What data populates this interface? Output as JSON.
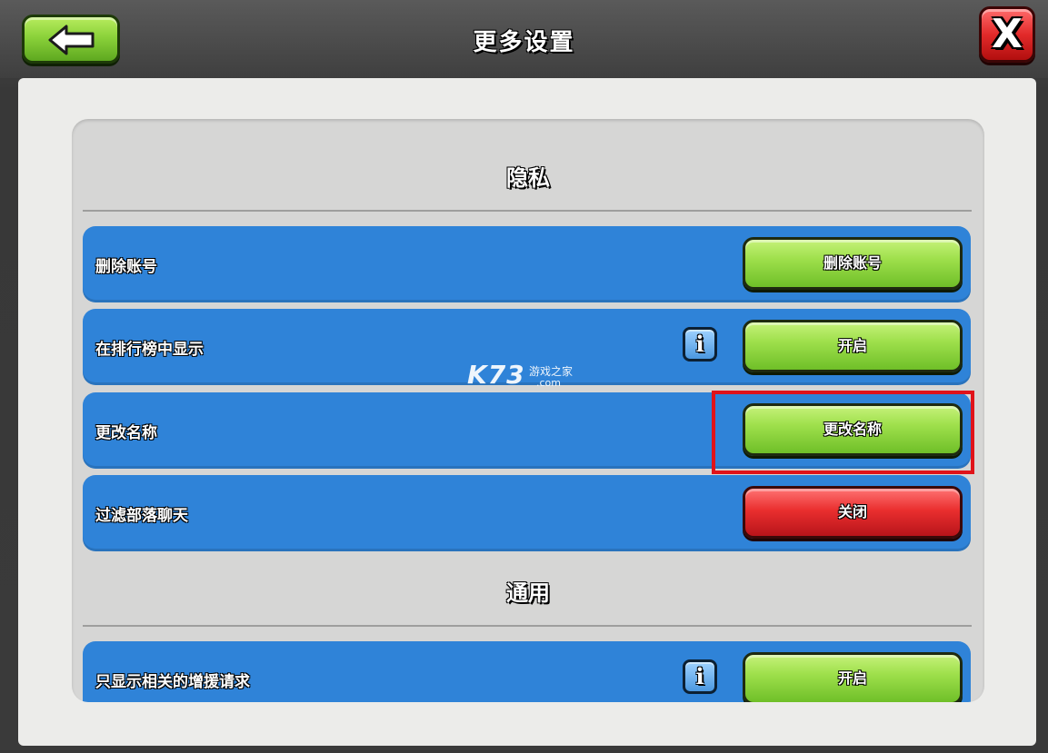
{
  "header": {
    "title": "更多设置"
  },
  "close_label": "X",
  "sections": {
    "privacy": {
      "title": "隐私",
      "rows": [
        {
          "label": "删除账号",
          "button": "删除账号"
        },
        {
          "label": "在排行榜中显示",
          "button": "开启"
        },
        {
          "label": "更改名称",
          "button": "更改名称"
        },
        {
          "label": "过滤部落聊天",
          "button": "关闭"
        }
      ]
    },
    "general": {
      "title": "通用",
      "rows": [
        {
          "label": "只显示相关的增援请求",
          "button": "开启"
        }
      ]
    }
  },
  "info_glyph": "i",
  "watermark": {
    "logo": "K73",
    "sub": "游戏之家",
    "domain": ".com"
  },
  "colors": {
    "row_blue": "#2f83d8",
    "button_green": "#9fe04c",
    "button_red": "#ea2f2f",
    "highlight_red": "#e0131a"
  },
  "icons": [
    "back-arrow-icon",
    "close-x-icon",
    "info-icon"
  ]
}
